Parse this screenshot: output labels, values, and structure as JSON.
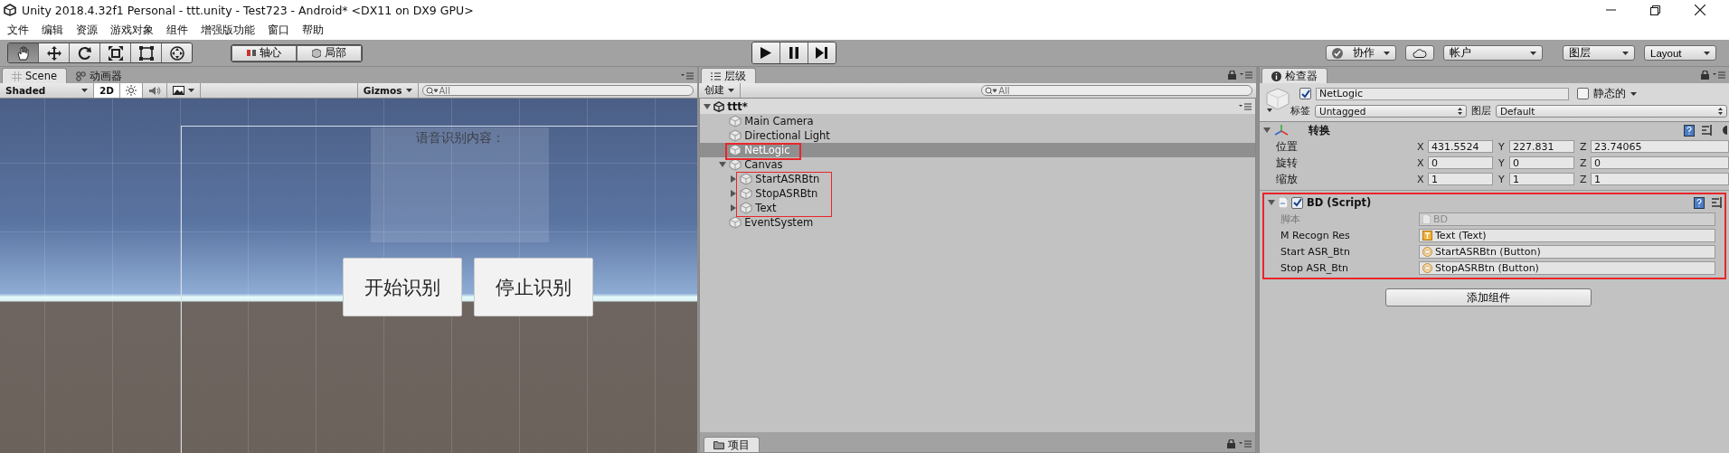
{
  "window": {
    "title": "Unity 2018.4.32f1 Personal - ttt.unity - Test723 - Android* <DX11 on DX9 GPU>"
  },
  "menu": [
    "文件",
    "编辑",
    "资源",
    "游戏对象",
    "组件",
    "增强版功能",
    "窗口",
    "帮助"
  ],
  "toolbar": {
    "tools": [
      {
        "selected": true
      },
      {
        "selected": false
      },
      {
        "selected": false
      },
      {
        "selected": false
      },
      {
        "selected": false
      },
      {
        "selected": false
      }
    ],
    "pivot": [
      "轴心",
      "局部"
    ],
    "collab": "协作",
    "account": "帐户",
    "layers": "图层",
    "layout": "Layout"
  },
  "scene_panel": {
    "tabs": [
      {
        "label": "Scene",
        "selected": true
      },
      {
        "label": "动画器",
        "selected": false
      }
    ],
    "shading": "Shaded",
    "toggles": [
      {
        "kind": "mode",
        "label": "2D",
        "on": true
      },
      {
        "kind": "light",
        "on": true
      },
      {
        "kind": "audio",
        "on": false
      },
      {
        "kind": "effects",
        "on": false
      }
    ],
    "gizmos": "Gizmos",
    "search_placeholder": "All",
    "canvas": {
      "label": "语音识别内容：",
      "buttons": [
        "开始识别",
        "停止识别"
      ]
    }
  },
  "hierarchy": {
    "tab": "层级",
    "create": "创建",
    "search_placeholder": "All",
    "scene": {
      "name": "ttt*",
      "expanded": true,
      "children": [
        {
          "name": "Main Camera",
          "selected": false
        },
        {
          "name": "Directional Light",
          "selected": false
        },
        {
          "name": "NetLogic",
          "selected": true
        },
        {
          "name": "Canvas",
          "selected": false,
          "expanded": true,
          "children": [
            {
              "name": "StartASRBtn",
              "selected": false,
              "expanded": false
            },
            {
              "name": "StopASRBtn",
              "selected": false,
              "expanded": false
            },
            {
              "name": "Text",
              "selected": false,
              "expanded": false
            }
          ]
        },
        {
          "name": "EventSystem",
          "selected": false
        }
      ]
    }
  },
  "project": {
    "tab": "项目"
  },
  "inspector": {
    "tab": "检查器",
    "object": {
      "active": true,
      "name": "NetLogic",
      "static_label": "静态的",
      "static": false,
      "tag_label": "标签",
      "tag": "Untagged",
      "layer_label": "图层",
      "layer": "Default"
    },
    "transform": {
      "title": "转换",
      "expanded": true,
      "rows": [
        {
          "label": "位置",
          "values": [
            {
              "axis": "X",
              "value": "431.5524"
            },
            {
              "axis": "Y",
              "value": "227.831"
            },
            {
              "axis": "Z",
              "value": "23.74065"
            }
          ]
        },
        {
          "label": "旋转",
          "values": [
            {
              "axis": "X",
              "value": "0"
            },
            {
              "axis": "Y",
              "value": "0"
            },
            {
              "axis": "Z",
              "value": "0"
            }
          ]
        },
        {
          "label": "缩放",
          "values": [
            {
              "axis": "X",
              "value": "1"
            },
            {
              "axis": "Y",
              "value": "1"
            },
            {
              "axis": "Z",
              "value": "1"
            }
          ]
        }
      ]
    },
    "script": {
      "title": "BD (Script)",
      "enabled": true,
      "expanded": true,
      "fields": [
        {
          "label": "脚本",
          "value": "BD",
          "kind": "script",
          "disabled": true
        },
        {
          "label": "M Recogn Res",
          "value": "Text (Text)",
          "kind": "text",
          "disabled": false
        },
        {
          "label": "Start ASR_Btn",
          "value": "StartASRBtn (Button)",
          "kind": "button",
          "disabled": false
        },
        {
          "label": "Stop ASR_Btn",
          "value": "StopASRBtn (Button)",
          "kind": "button",
          "disabled": false
        }
      ]
    },
    "add_component": "添加组件"
  }
}
